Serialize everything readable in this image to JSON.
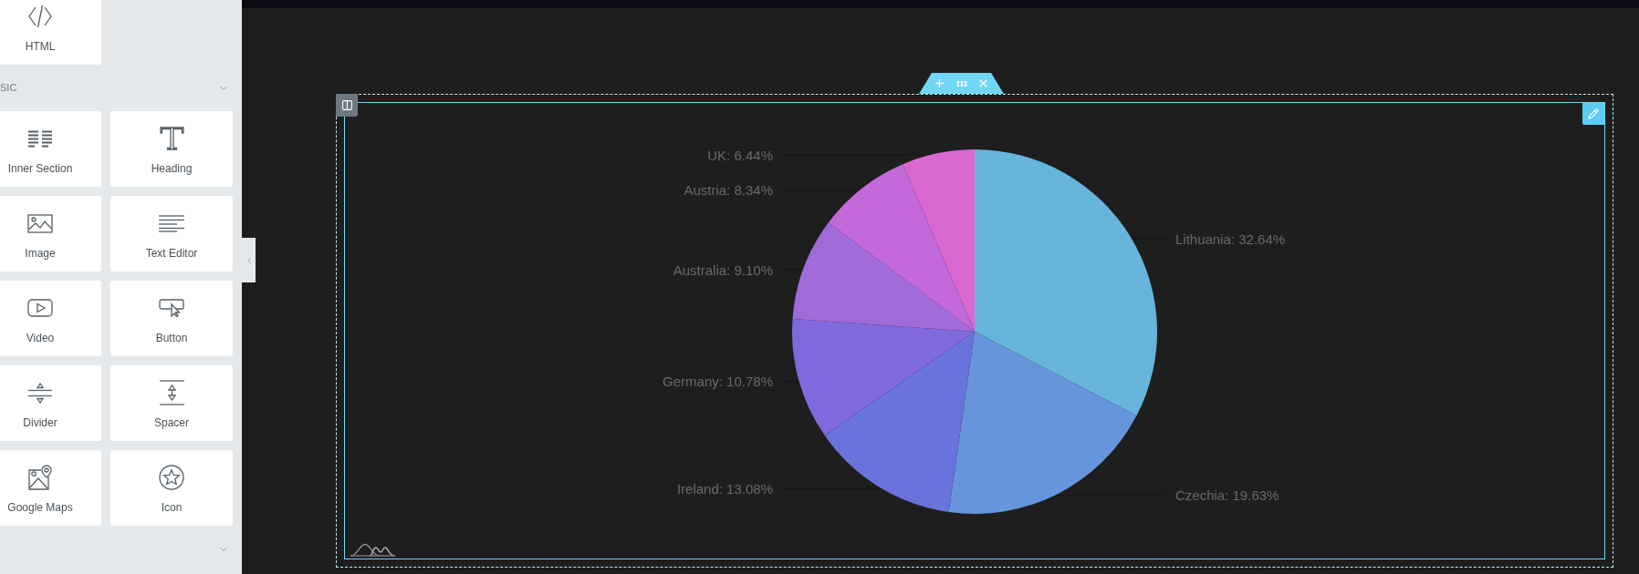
{
  "sidebar": {
    "panels": [
      {
        "kind": "grid",
        "widgets": [
          {
            "kind": "html",
            "label": "HTML"
          }
        ]
      },
      {
        "kind": "header",
        "title": "SIC"
      },
      {
        "kind": "grid",
        "widgets": [
          {
            "kind": "section",
            "label": "Inner Section"
          },
          {
            "kind": "heading",
            "label": "Heading"
          },
          {
            "kind": "image",
            "label": "Image"
          },
          {
            "kind": "text",
            "label": "Text Editor"
          },
          {
            "kind": "video",
            "label": "Video"
          },
          {
            "kind": "button",
            "label": "Button"
          },
          {
            "kind": "divider",
            "label": "Divider"
          },
          {
            "kind": "spacer",
            "label": "Spacer"
          },
          {
            "kind": "map",
            "label": "Google Maps"
          },
          {
            "kind": "star",
            "label": "Icon"
          }
        ]
      },
      {
        "kind": "header"
      }
    ]
  },
  "canvas": {
    "section": {
      "widget": {
        "chart_data": {
          "type": "pie",
          "values": [
            32.64,
            19.63,
            13.08,
            10.78,
            9.1,
            8.34,
            6.44
          ],
          "colors": [
            "#67b5db",
            "#6795dc",
            "#6973db",
            "#7f69dc",
            "#a06ad9",
            "#c369da",
            "#d968cf"
          ],
          "value_labels": [
            "Lithuania: 32.64%",
            "Czechia: 19.63%",
            "Ireland: 13.08%",
            "Germany: 10.78%",
            "Australia: 9.10%",
            "Austria: 8.34%",
            "UK: 6.44%"
          ]
        }
      }
    }
  }
}
